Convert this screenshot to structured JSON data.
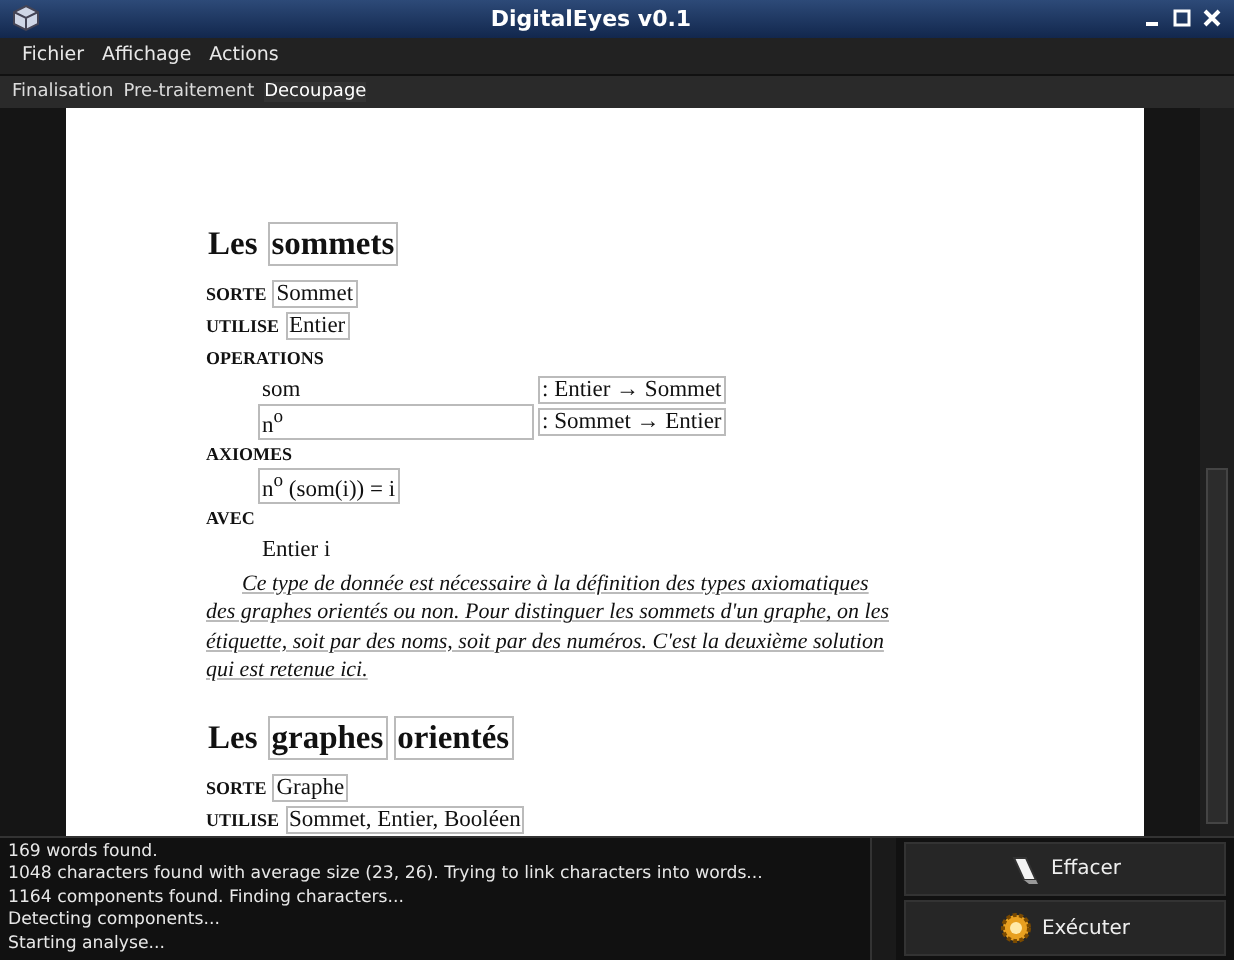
{
  "window": {
    "title": "DigitalEyes v0.1"
  },
  "menu": [
    "Fichier",
    "Affichage",
    "Actions"
  ],
  "tabs": [
    {
      "label": "Finalisation",
      "selected": false
    },
    {
      "label": "Pre-traitement",
      "selected": false
    },
    {
      "label": "Decoupage",
      "selected": true
    }
  ],
  "document": {
    "blocks": [
      {
        "kind": "heading",
        "parts": [
          {
            "text": "Les",
            "boxed": false
          },
          {
            "text": "sommets",
            "boxed": true
          }
        ]
      },
      {
        "kind": "decl",
        "keyword": "SORTE",
        "parts": [
          {
            "text": "Sommet",
            "boxed": true
          }
        ]
      },
      {
        "kind": "decl",
        "keyword": "UTILISE",
        "parts": [
          {
            "text": "Entier",
            "boxed": true
          }
        ]
      },
      {
        "kind": "section",
        "keyword": "OPERATIONS"
      },
      {
        "kind": "op",
        "name": "som",
        "signature": ": Entier → Sommet",
        "boxed": false
      },
      {
        "kind": "op",
        "name": "n$^{o}$",
        "signature": ": Sommet → Entier",
        "boxed": true
      },
      {
        "kind": "section",
        "keyword": "AXIOMES"
      },
      {
        "kind": "indent",
        "text": "n$^{o}$ (som(i)) = i",
        "boxed": true
      },
      {
        "kind": "section",
        "keyword": "AVEC"
      },
      {
        "kind": "indent",
        "text": "Entier i",
        "boxed": false
      },
      {
        "kind": "para",
        "lines": [
          "Ce type de donnée est nécessaire à la définition des types axiomatiques",
          "des graphes orientés ou non. Pour distinguer les sommets d'un graphe, on les",
          "étiquette, soit par des noms, soit par des numéros. C'est la deuxième solution",
          "qui est retenue ici."
        ]
      },
      {
        "kind": "heading",
        "parts": [
          {
            "text": "Les",
            "boxed": false
          },
          {
            "text": "graphes",
            "boxed": true
          },
          {
            "text": "orientés",
            "boxed": true
          }
        ]
      },
      {
        "kind": "decl",
        "keyword": "SORTE",
        "parts": [
          {
            "text": "Graphe",
            "boxed": true
          }
        ]
      },
      {
        "kind": "decl",
        "keyword": "UTILISE",
        "parts": [
          {
            "text": "Sommet, Entier, Booléen",
            "boxed": true
          }
        ]
      }
    ]
  },
  "log": [
    "169 words found.",
    "1048 characters found with average size (23, 26). Trying to link characters into words...",
    "1164 components found. Finding characters...",
    "Detecting components...",
    "Starting analyse..."
  ],
  "buttons": [
    {
      "kind": "clear",
      "label": "Effacer"
    },
    {
      "kind": "run",
      "label": "Exécuter"
    }
  ]
}
